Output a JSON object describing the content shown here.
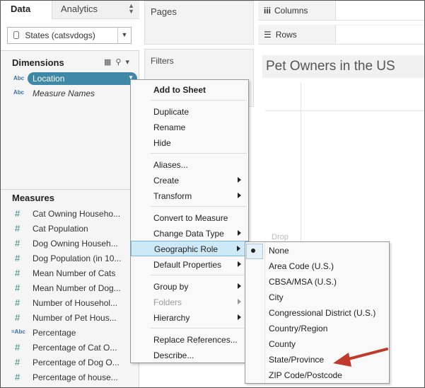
{
  "left_pane": {
    "tabs": {
      "data": "Data",
      "analytics": "Analytics"
    },
    "datasource": {
      "name": "States (catsvdogs)"
    },
    "dimensions": {
      "title": "Dimensions",
      "fields": [
        {
          "type": "Abc",
          "name": "Location",
          "selected": true
        },
        {
          "type": "Abc",
          "name": "Measure Names",
          "italic": true
        }
      ]
    },
    "measures": {
      "title": "Measures",
      "fields": [
        {
          "type": "#",
          "name": "Cat Owning Househo..."
        },
        {
          "type": "#",
          "name": "Cat Population"
        },
        {
          "type": "#",
          "name": "Dog Owning Househ..."
        },
        {
          "type": "#",
          "name": "Dog Population (in 10..."
        },
        {
          "type": "#",
          "name": "Mean Number of Cats"
        },
        {
          "type": "#",
          "name": "Mean Number of Dog..."
        },
        {
          "type": "#",
          "name": "Number of Househol..."
        },
        {
          "type": "#",
          "name": "Number of Pet Hous..."
        },
        {
          "type": "=Abc",
          "name": "Percentage"
        },
        {
          "type": "#",
          "name": "Percentage of Cat O..."
        },
        {
          "type": "#",
          "name": "Percentage of Dog O..."
        },
        {
          "type": "#",
          "name": "Percentage of house..."
        }
      ]
    }
  },
  "shelves": {
    "pages": "Pages",
    "filters": "Filters",
    "columns": {
      "icon": "iii",
      "label": "Columns"
    },
    "rows": {
      "icon": "☰",
      "label": "Rows"
    }
  },
  "view": {
    "title": "Pet Owners in the US",
    "drop_hint": "Drop"
  },
  "context_menu": {
    "items": [
      {
        "label": "Add to Sheet",
        "bold": true
      },
      {
        "separator": true
      },
      {
        "label": "Duplicate"
      },
      {
        "label": "Rename"
      },
      {
        "label": "Hide"
      },
      {
        "separator": true
      },
      {
        "label": "Aliases..."
      },
      {
        "label": "Create",
        "submenu": true
      },
      {
        "label": "Transform",
        "submenu": true
      },
      {
        "separator": true
      },
      {
        "label": "Convert to Measure"
      },
      {
        "label": "Change Data Type",
        "submenu": true
      },
      {
        "label": "Geographic Role",
        "submenu": true,
        "active": true
      },
      {
        "label": "Default Properties",
        "submenu": true
      },
      {
        "separator": true
      },
      {
        "label": "Group by",
        "submenu": true
      },
      {
        "label": "Folders",
        "submenu": true,
        "disabled": true
      },
      {
        "label": "Hierarchy",
        "submenu": true
      },
      {
        "separator": true
      },
      {
        "label": "Replace References..."
      },
      {
        "label": "Describe..."
      }
    ]
  },
  "geographic_role_submenu": {
    "selected": "None",
    "items": [
      "None",
      "Area Code (U.S.)",
      "CBSA/MSA (U.S.)",
      "City",
      "Congressional District (U.S.)",
      "Country/Region",
      "County",
      "State/Province",
      "ZIP Code/Postcode"
    ]
  },
  "colors": {
    "selected_pill": "#3f88a8",
    "menu_highlight": "#cde8f6",
    "annotation_arrow": "#c0392b",
    "measure_icon": "#2e8b7a",
    "dimension_icon": "#3a6ea5"
  }
}
